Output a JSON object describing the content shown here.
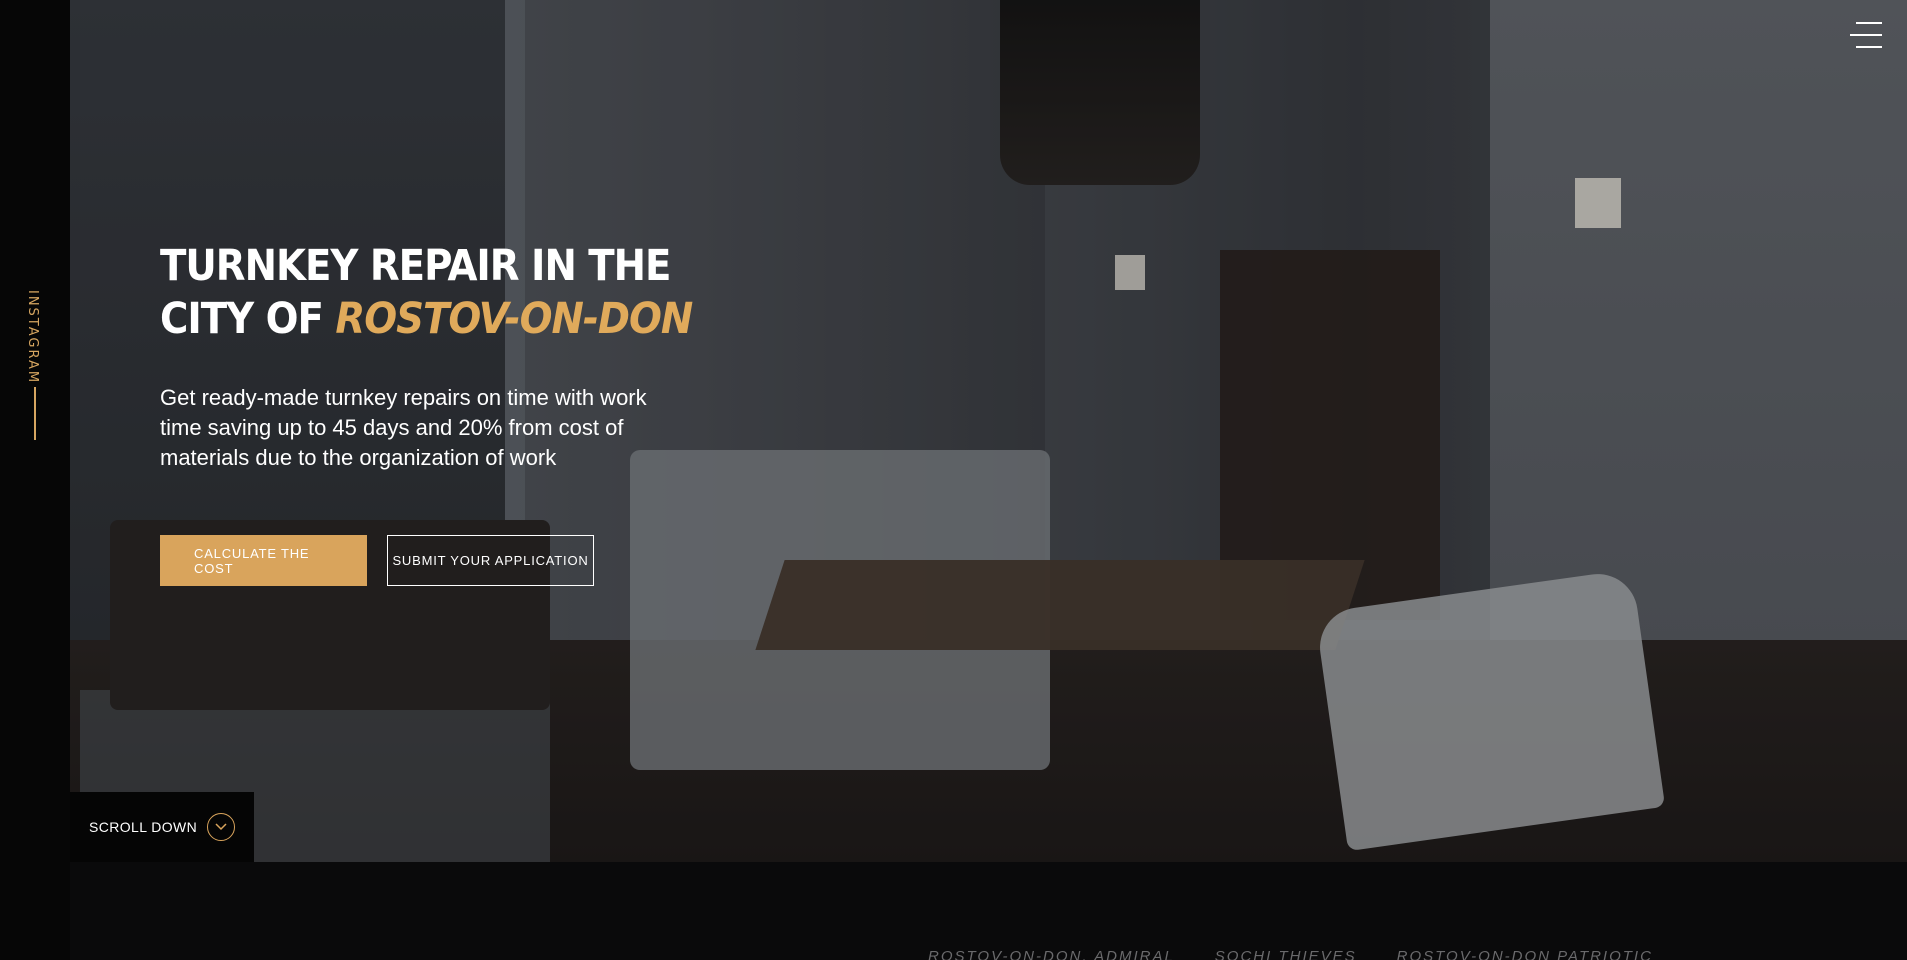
{
  "sidebar": {
    "social_label": "INSTAGRAM"
  },
  "hero": {
    "title_part1": "TURNKEY REPAIR IN THE",
    "title_part2": "CITY OF",
    "title_accent": "ROSTOV-ON-DON",
    "description": "Get ready-made turnkey repairs on time with work time saving up to 45 days and 20% from cost of materials due to the organization of work",
    "primary_button": "CALCULATE THE COST",
    "secondary_button": "SUBMIT YOUR APPLICATION"
  },
  "scroll": {
    "label": "SCROLL DOWN",
    "icon": "chevron-down-icon"
  },
  "header": {
    "menu_icon": "hamburger-menu-icon"
  },
  "projects": {
    "tabs": [
      "ROSTOV-ON-DON, ADMIRAL",
      "SOCHI THIEVES",
      "ROSTOV-ON-DON PATRIOTIC"
    ]
  },
  "colors": {
    "accent": "#d9a45c",
    "background": "#0a0a0b",
    "text": "#ffffff"
  }
}
